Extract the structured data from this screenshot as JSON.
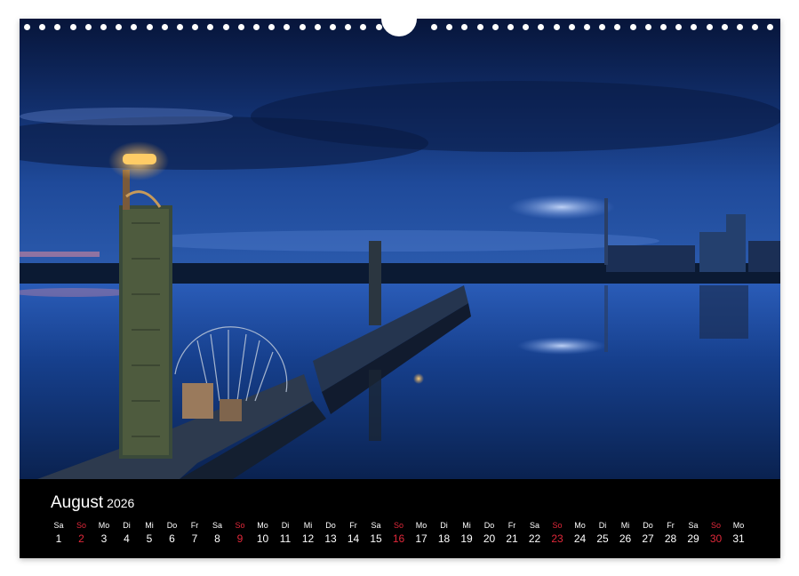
{
  "calendar": {
    "month": "August",
    "year": "2026",
    "sunday_color": "#e0283a",
    "days": [
      {
        "wd": "Sa",
        "day": "1",
        "sunday": false
      },
      {
        "wd": "So",
        "day": "2",
        "sunday": true
      },
      {
        "wd": "Mo",
        "day": "3",
        "sunday": false
      },
      {
        "wd": "Di",
        "day": "4",
        "sunday": false
      },
      {
        "wd": "Mi",
        "day": "5",
        "sunday": false
      },
      {
        "wd": "Do",
        "day": "6",
        "sunday": false
      },
      {
        "wd": "Fr",
        "day": "7",
        "sunday": false
      },
      {
        "wd": "Sa",
        "day": "8",
        "sunday": false
      },
      {
        "wd": "So",
        "day": "9",
        "sunday": true
      },
      {
        "wd": "Mo",
        "day": "10",
        "sunday": false
      },
      {
        "wd": "Di",
        "day": "11",
        "sunday": false
      },
      {
        "wd": "Mi",
        "day": "12",
        "sunday": false
      },
      {
        "wd": "Do",
        "day": "13",
        "sunday": false
      },
      {
        "wd": "Fr",
        "day": "14",
        "sunday": false
      },
      {
        "wd": "Sa",
        "day": "15",
        "sunday": false
      },
      {
        "wd": "So",
        "day": "16",
        "sunday": true
      },
      {
        "wd": "Mo",
        "day": "17",
        "sunday": false
      },
      {
        "wd": "Di",
        "day": "18",
        "sunday": false
      },
      {
        "wd": "Mi",
        "day": "19",
        "sunday": false
      },
      {
        "wd": "Do",
        "day": "20",
        "sunday": false
      },
      {
        "wd": "Fr",
        "day": "21",
        "sunday": false
      },
      {
        "wd": "Sa",
        "day": "22",
        "sunday": false
      },
      {
        "wd": "So",
        "day": "23",
        "sunday": true
      },
      {
        "wd": "Mo",
        "day": "24",
        "sunday": false
      },
      {
        "wd": "Di",
        "day": "25",
        "sunday": false
      },
      {
        "wd": "Mi",
        "day": "26",
        "sunday": false
      },
      {
        "wd": "Do",
        "day": "27",
        "sunday": false
      },
      {
        "wd": "Fr",
        "day": "28",
        "sunday": false
      },
      {
        "wd": "Sa",
        "day": "29",
        "sunday": false
      },
      {
        "wd": "So",
        "day": "30",
        "sunday": true
      },
      {
        "wd": "Mo",
        "day": "31",
        "sunday": false
      }
    ]
  },
  "photo": {
    "sky_top_color": "#0a1f4d",
    "water_color": "#0e2e6e",
    "lamp_color": "#ffb347"
  }
}
